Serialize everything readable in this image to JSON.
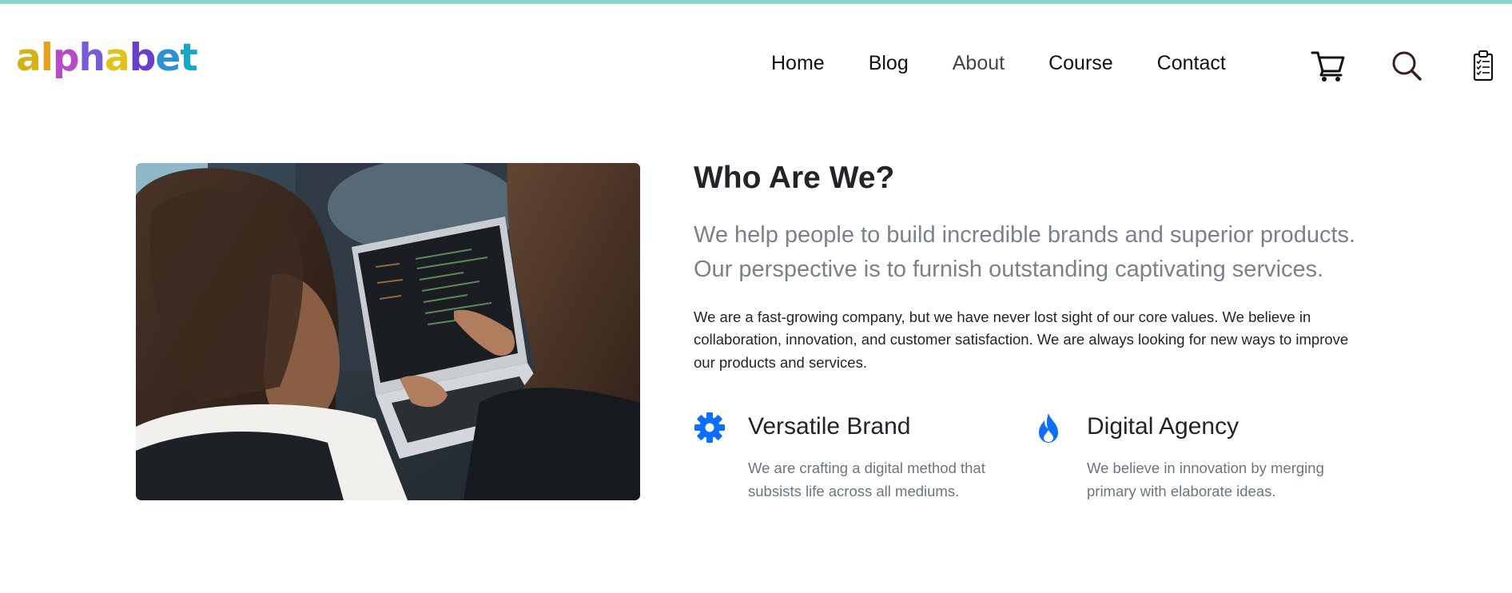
{
  "brand": {
    "logo_letters": [
      {
        "char": "a",
        "color": "#d4b21a"
      },
      {
        "char": "l",
        "color": "#e5a21c"
      },
      {
        "char": "p",
        "color": "#b84cc7"
      },
      {
        "char": "h",
        "color": "#7a5bd6"
      },
      {
        "char": "a",
        "color": "#e0c21a"
      },
      {
        "char": "b",
        "color": "#6a3fc9"
      },
      {
        "char": "e",
        "color": "#2d8fd4"
      },
      {
        "char": "t",
        "color": "#18a7c4"
      }
    ],
    "topline_color": "#8fd3cf"
  },
  "nav": {
    "links": [
      {
        "label": "Home",
        "active": false
      },
      {
        "label": "Blog",
        "active": false
      },
      {
        "label": "About",
        "active": true
      },
      {
        "label": "Course",
        "active": false
      },
      {
        "label": "Contact",
        "active": false
      }
    ],
    "icons": [
      "cart-icon",
      "search-icon",
      "clipboard-checklist-icon"
    ]
  },
  "about": {
    "heading": "Who Are We?",
    "lead_line_1": "We help people to build incredible brands and superior products.",
    "lead_line_2": "Our perspective is to furnish outstanding captivating services.",
    "body": "We are a fast-growing company, but we have never lost sight of our core values. We believe in collaboration, innovation, and customer satisfaction. We are always looking for new ways to improve our products and services."
  },
  "features": [
    {
      "icon": "gear-icon",
      "title": "Versatile Brand",
      "description": "We are crafting a digital method that subsists life across all mediums."
    },
    {
      "icon": "fire-icon",
      "title": "Digital Agency",
      "description": "We believe in innovation by merging primary with elaborate ideas."
    }
  ],
  "colors": {
    "accent": "#0d6efd",
    "muted": "#6c757d"
  }
}
